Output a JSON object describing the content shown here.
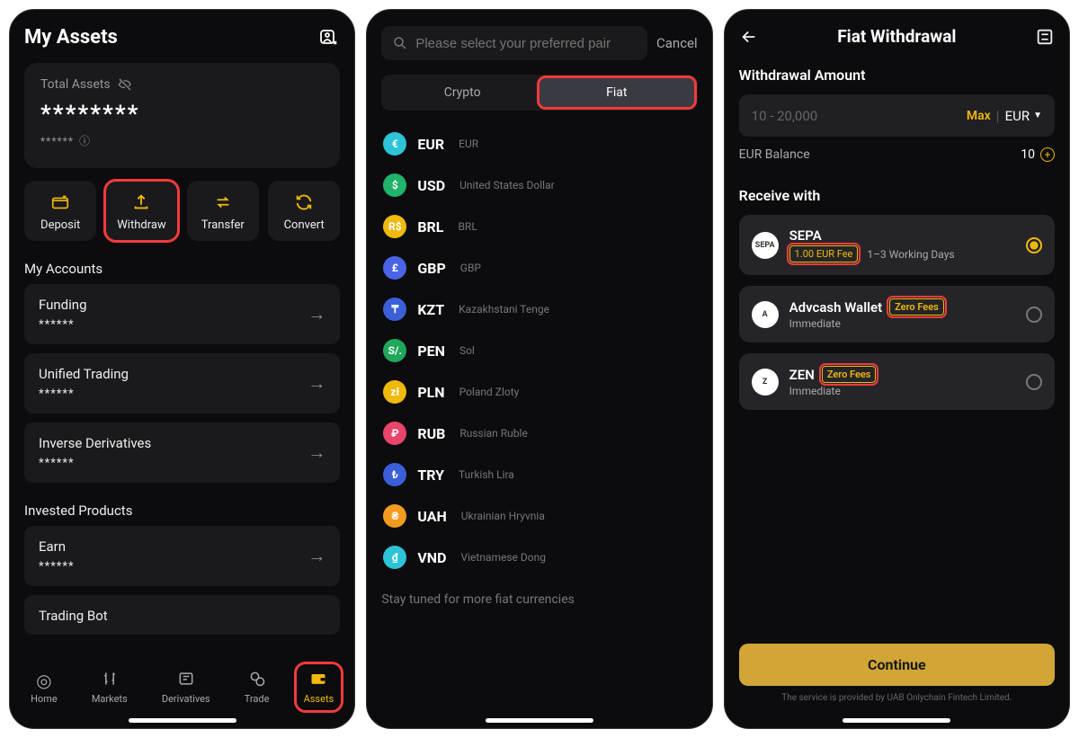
{
  "screen1": {
    "title": "My Assets",
    "total_label": "Total Assets",
    "total_hidden": "********",
    "total_sub_hidden": "******",
    "actions": {
      "deposit": "Deposit",
      "withdraw": "Withdraw",
      "transfer": "Transfer",
      "convert": "Convert"
    },
    "accounts_title": "My Accounts",
    "accounts": [
      {
        "name": "Funding",
        "value": "******"
      },
      {
        "name": "Unified Trading",
        "value": "******"
      },
      {
        "name": "Inverse Derivatives",
        "value": "******"
      }
    ],
    "invested_title": "Invested Products",
    "invested": [
      {
        "name": "Earn",
        "value": "******"
      },
      {
        "name": "Trading Bot",
        "value": ""
      }
    ],
    "nav": {
      "home": "Home",
      "markets": "Markets",
      "derivatives": "Derivatives",
      "trade": "Trade",
      "assets": "Assets"
    }
  },
  "screen2": {
    "search_placeholder": "Please select your preferred pair",
    "cancel": "Cancel",
    "tab_crypto": "Crypto",
    "tab_fiat": "Fiat",
    "currencies": [
      {
        "code": "EUR",
        "name": "EUR",
        "color": "#2cc4d6",
        "sym": "€"
      },
      {
        "code": "USD",
        "name": "United States Dollar",
        "color": "#1fb36b",
        "sym": "$"
      },
      {
        "code": "BRL",
        "name": "BRL",
        "color": "#f0b90b",
        "sym": "R$"
      },
      {
        "code": "GBP",
        "name": "GBP",
        "color": "#4a64e8",
        "sym": "£"
      },
      {
        "code": "KZT",
        "name": "Kazakhstani Tenge",
        "color": "#3a5fd9",
        "sym": "₸"
      },
      {
        "code": "PEN",
        "name": "Sol",
        "color": "#1fa85a",
        "sym": "S/."
      },
      {
        "code": "PLN",
        "name": "Poland Zloty",
        "color": "#f0b90b",
        "sym": "zł"
      },
      {
        "code": "RUB",
        "name": "Russian Ruble",
        "color": "#e8456b",
        "sym": "₽"
      },
      {
        "code": "TRY",
        "name": "Turkish Lira",
        "color": "#3a5fd9",
        "sym": "₺"
      },
      {
        "code": "UAH",
        "name": "Ukrainian Hryvnia",
        "color": "#f29b1f",
        "sym": "₴"
      },
      {
        "code": "VND",
        "name": "Vietnamese Dong",
        "color": "#2cc4d6",
        "sym": "₫"
      }
    ],
    "more_text": "Stay tuned for more fiat currencies"
  },
  "screen3": {
    "title": "Fiat Withdrawal",
    "amount_label": "Withdrawal Amount",
    "amount_placeholder": "10 - 20,000",
    "max_label": "Max",
    "currency": "EUR",
    "balance_label": "EUR Balance",
    "balance_value": "10",
    "receive_label": "Receive with",
    "methods": [
      {
        "name": "SEPA",
        "icon": "SEPA",
        "fee": "1.00 EUR Fee",
        "timing": "1–3 Working Days",
        "selected": true,
        "badge_inline": false
      },
      {
        "name": "Advcash Wallet",
        "icon": "A",
        "fee": "Zero Fees",
        "timing": "Immediate",
        "selected": false,
        "badge_inline": true
      },
      {
        "name": "ZEN",
        "icon": "Z",
        "fee": "Zero Fees",
        "timing": "Immediate",
        "selected": false,
        "badge_inline": true
      }
    ],
    "continue": "Continue",
    "disclaimer": "The service is provided by UAB Onlychain Fintech Limited."
  }
}
